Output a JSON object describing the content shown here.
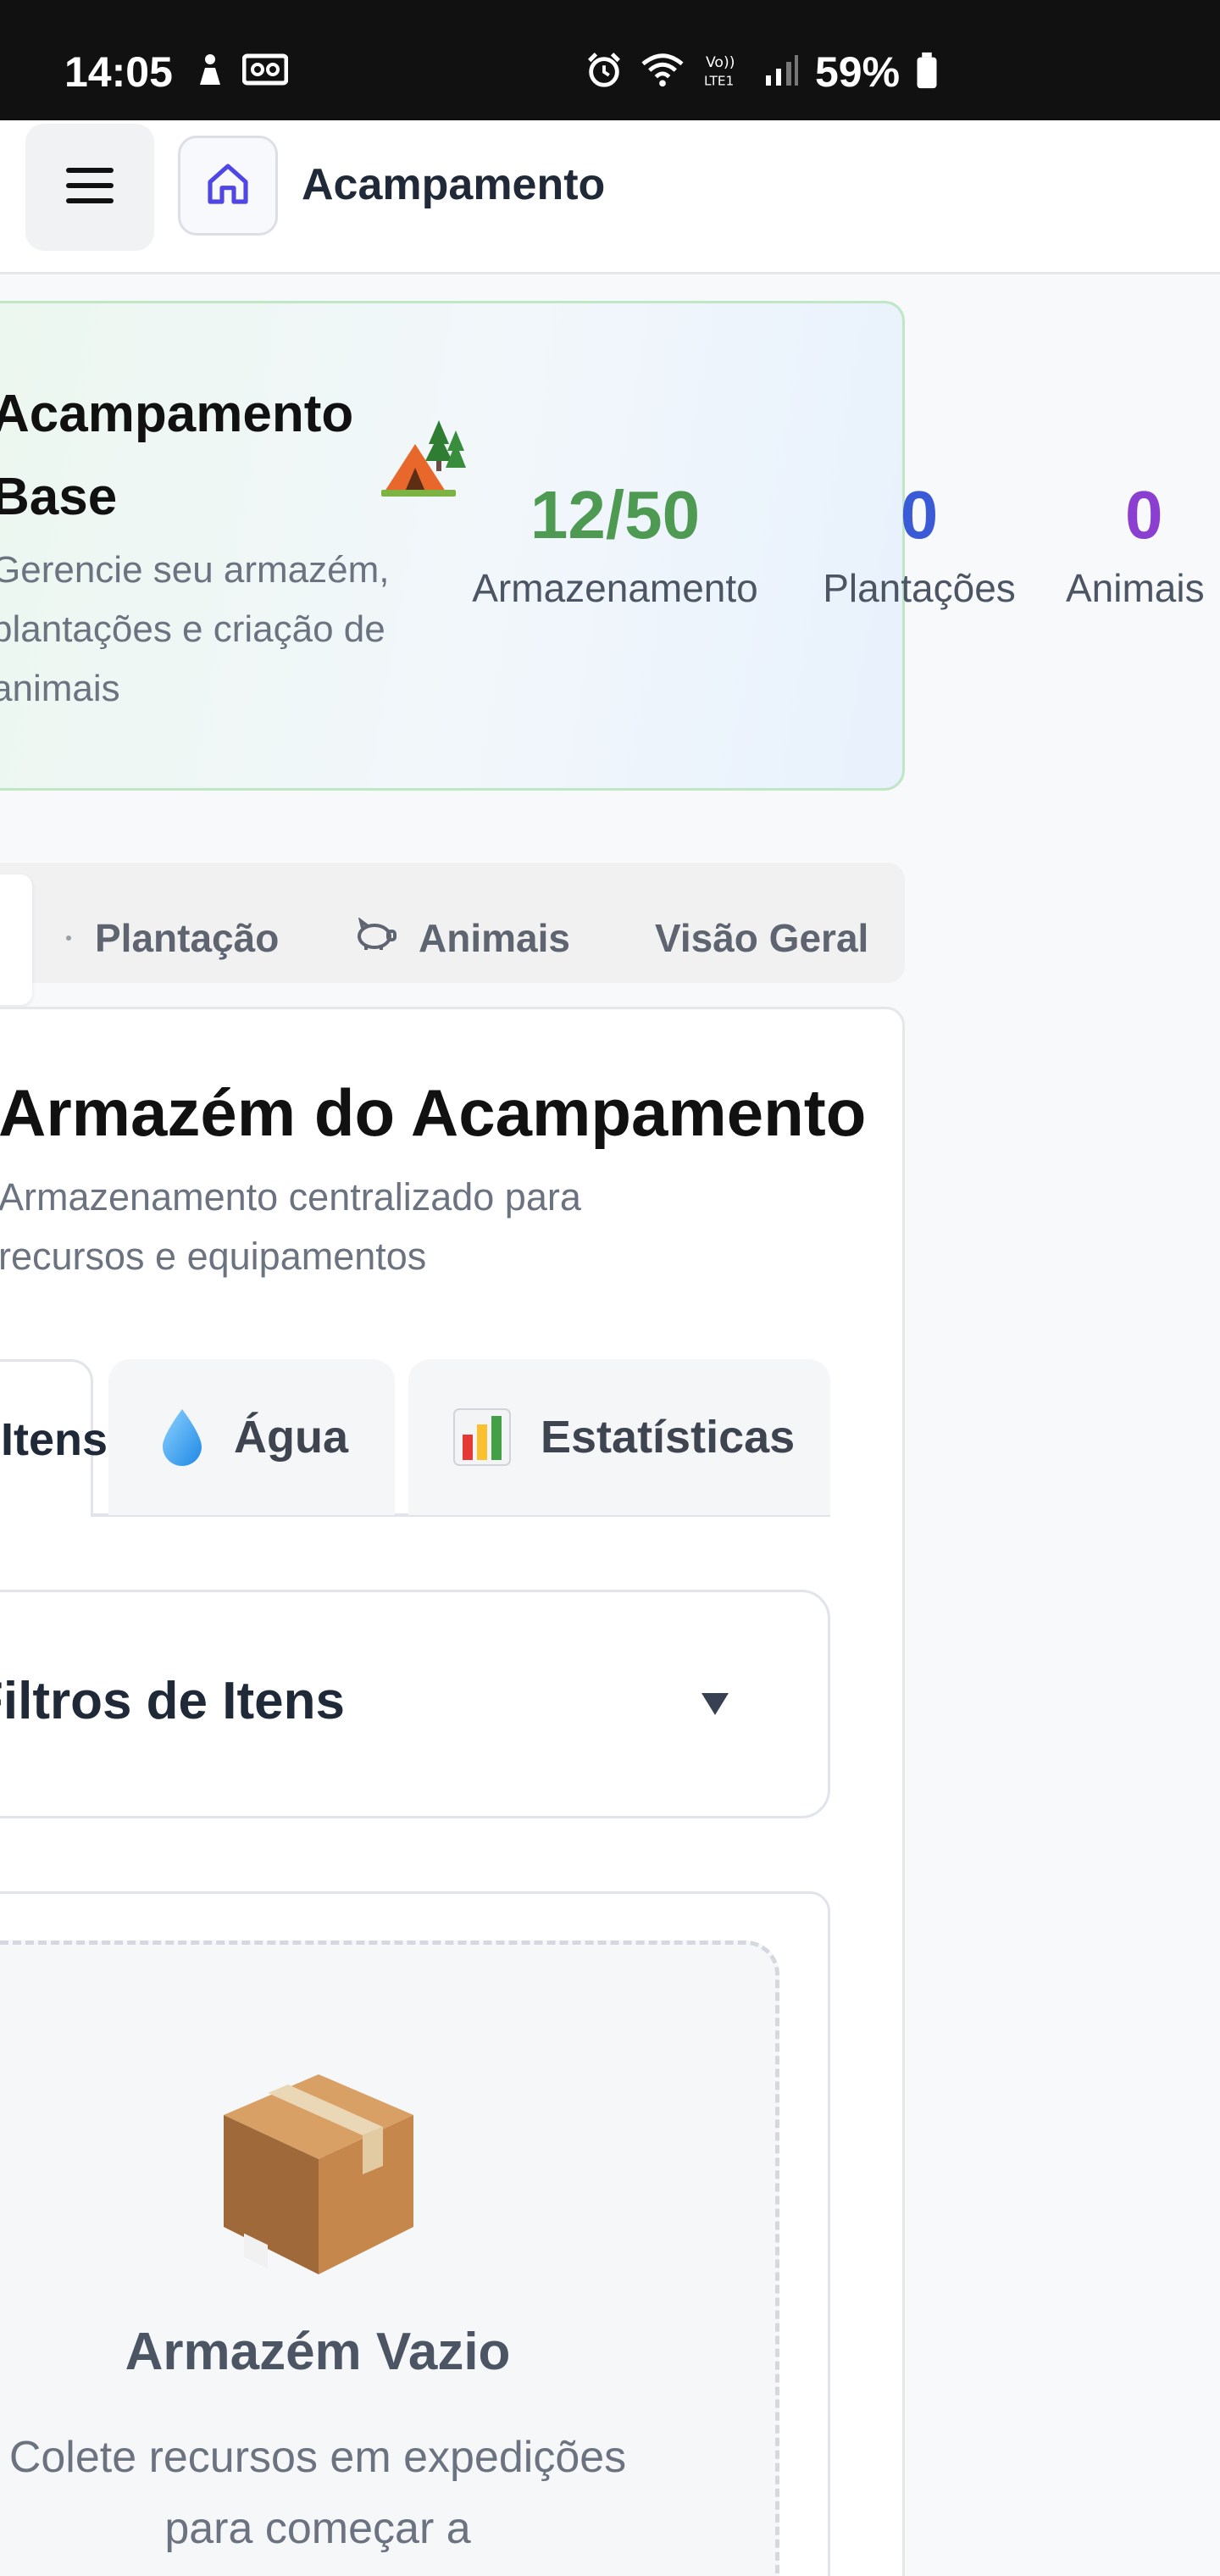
{
  "status_bar": {
    "time": "14:05",
    "battery": "59%",
    "icons": [
      "person-icon",
      "voicemail-icon",
      "alarm-icon",
      "wifi-icon",
      "volte-icon",
      "signal-icon",
      "battery-icon"
    ]
  },
  "header": {
    "title": "Acampamento",
    "icons": [
      "menu-icon",
      "home-icon"
    ]
  },
  "hero": {
    "title": "Acampamento Base",
    "emoji": "camping-tent-emoji",
    "description": "Gerencie seu armazém, plantações e criação de animais",
    "stats": [
      {
        "value": "12/50",
        "label": "Armazenamento",
        "color": "#4e9a52"
      },
      {
        "value": "0",
        "label": "Plantações",
        "color": "#3b5bd6"
      },
      {
        "value": "0",
        "label": "Animais",
        "color": "#8a3fd1"
      }
    ]
  },
  "main_tabs": [
    {
      "label": "Plantação",
      "icon": "plant-icon"
    },
    {
      "label": "Animais",
      "icon": "pig-icon"
    },
    {
      "label": "Visão Geral",
      "icon": ""
    }
  ],
  "warehouse": {
    "title": "Armazém do Acampamento",
    "description": "Armazenamento centralizado para recursos e equipamentos",
    "sub_tabs": [
      {
        "label": "Itens",
        "active": true
      },
      {
        "label": "Água",
        "icon": "water-drop-icon"
      },
      {
        "label": "Estatísticas",
        "icon": "bar-chart-icon"
      }
    ],
    "filters": {
      "title": "Filtros de Itens",
      "toggle": "▼"
    },
    "empty": {
      "icon": "package-icon",
      "title": "Armazém Vazio",
      "description": "Colete recursos em expedições para começar a"
    }
  },
  "colors": {
    "accent_green": "#4e9a52",
    "accent_blue": "#3b5bd6",
    "accent_purple": "#8a3fd1",
    "home_icon": "#4f46e5"
  }
}
